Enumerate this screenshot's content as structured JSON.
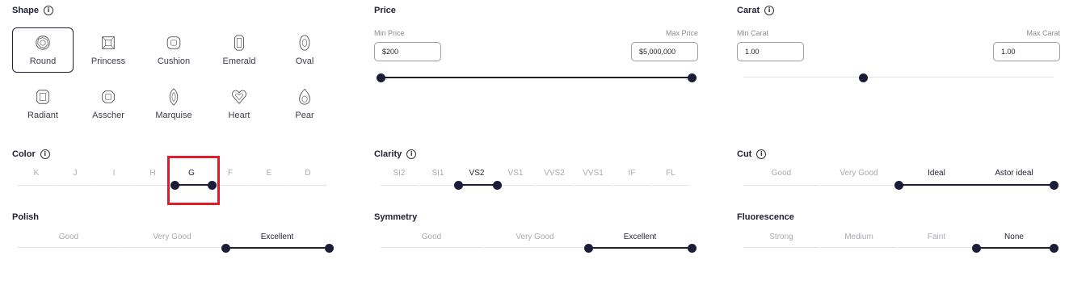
{
  "shape": {
    "title": "Shape",
    "items": [
      {
        "label": "Round",
        "icon": "round-diamond-icon",
        "active": true
      },
      {
        "label": "Princess",
        "icon": "princess-diamond-icon"
      },
      {
        "label": "Cushion",
        "icon": "cushion-diamond-icon"
      },
      {
        "label": "Emerald",
        "icon": "emerald-diamond-icon"
      },
      {
        "label": "Oval",
        "icon": "oval-diamond-icon"
      },
      {
        "label": "Radiant",
        "icon": "radiant-diamond-icon"
      },
      {
        "label": "Asscher",
        "icon": "asscher-diamond-icon"
      },
      {
        "label": "Marquise",
        "icon": "marquise-diamond-icon"
      },
      {
        "label": "Heart",
        "icon": "heart-diamond-icon"
      },
      {
        "label": "Pear",
        "icon": "pear-diamond-icon"
      }
    ]
  },
  "price": {
    "title": "Price",
    "min_label": "Min Price",
    "max_label": "Max Price",
    "min_value": "$200",
    "max_value": "$5,000,000"
  },
  "carat": {
    "title": "Carat",
    "min_label": "Min Carat",
    "max_label": "Max Carat",
    "min_value": "1.00",
    "max_value": "1.00"
  },
  "color": {
    "title": "Color",
    "grades": [
      "K",
      "J",
      "I",
      "H",
      "G",
      "F",
      "E",
      "D"
    ],
    "selected": [
      "G"
    ]
  },
  "clarity": {
    "title": "Clarity",
    "grades": [
      "SI2",
      "SI1",
      "VS2",
      "VS1",
      "VVS2",
      "VVS1",
      "IF",
      "FL"
    ],
    "selected": [
      "VS2"
    ]
  },
  "cut": {
    "title": "Cut",
    "grades": [
      "Good",
      "Very Good",
      "Ideal",
      "Astor ideal"
    ],
    "selected": [
      "Ideal",
      "Astor ideal"
    ]
  },
  "polish": {
    "title": "Polish",
    "grades": [
      "Good",
      "Very Good",
      "Excellent"
    ],
    "selected": [
      "Excellent"
    ]
  },
  "symmetry": {
    "title": "Symmetry",
    "grades": [
      "Good",
      "Very Good",
      "Excellent"
    ],
    "selected": [
      "Excellent"
    ]
  },
  "fluorescence": {
    "title": "Fluorescence",
    "grades": [
      "Strong",
      "Medium",
      "Faint",
      "None"
    ],
    "selected": [
      "None"
    ]
  },
  "colors": {
    "accent": "#1a1c3a",
    "highlight": "#e21b2a",
    "muted_text": "#a8aab4"
  }
}
